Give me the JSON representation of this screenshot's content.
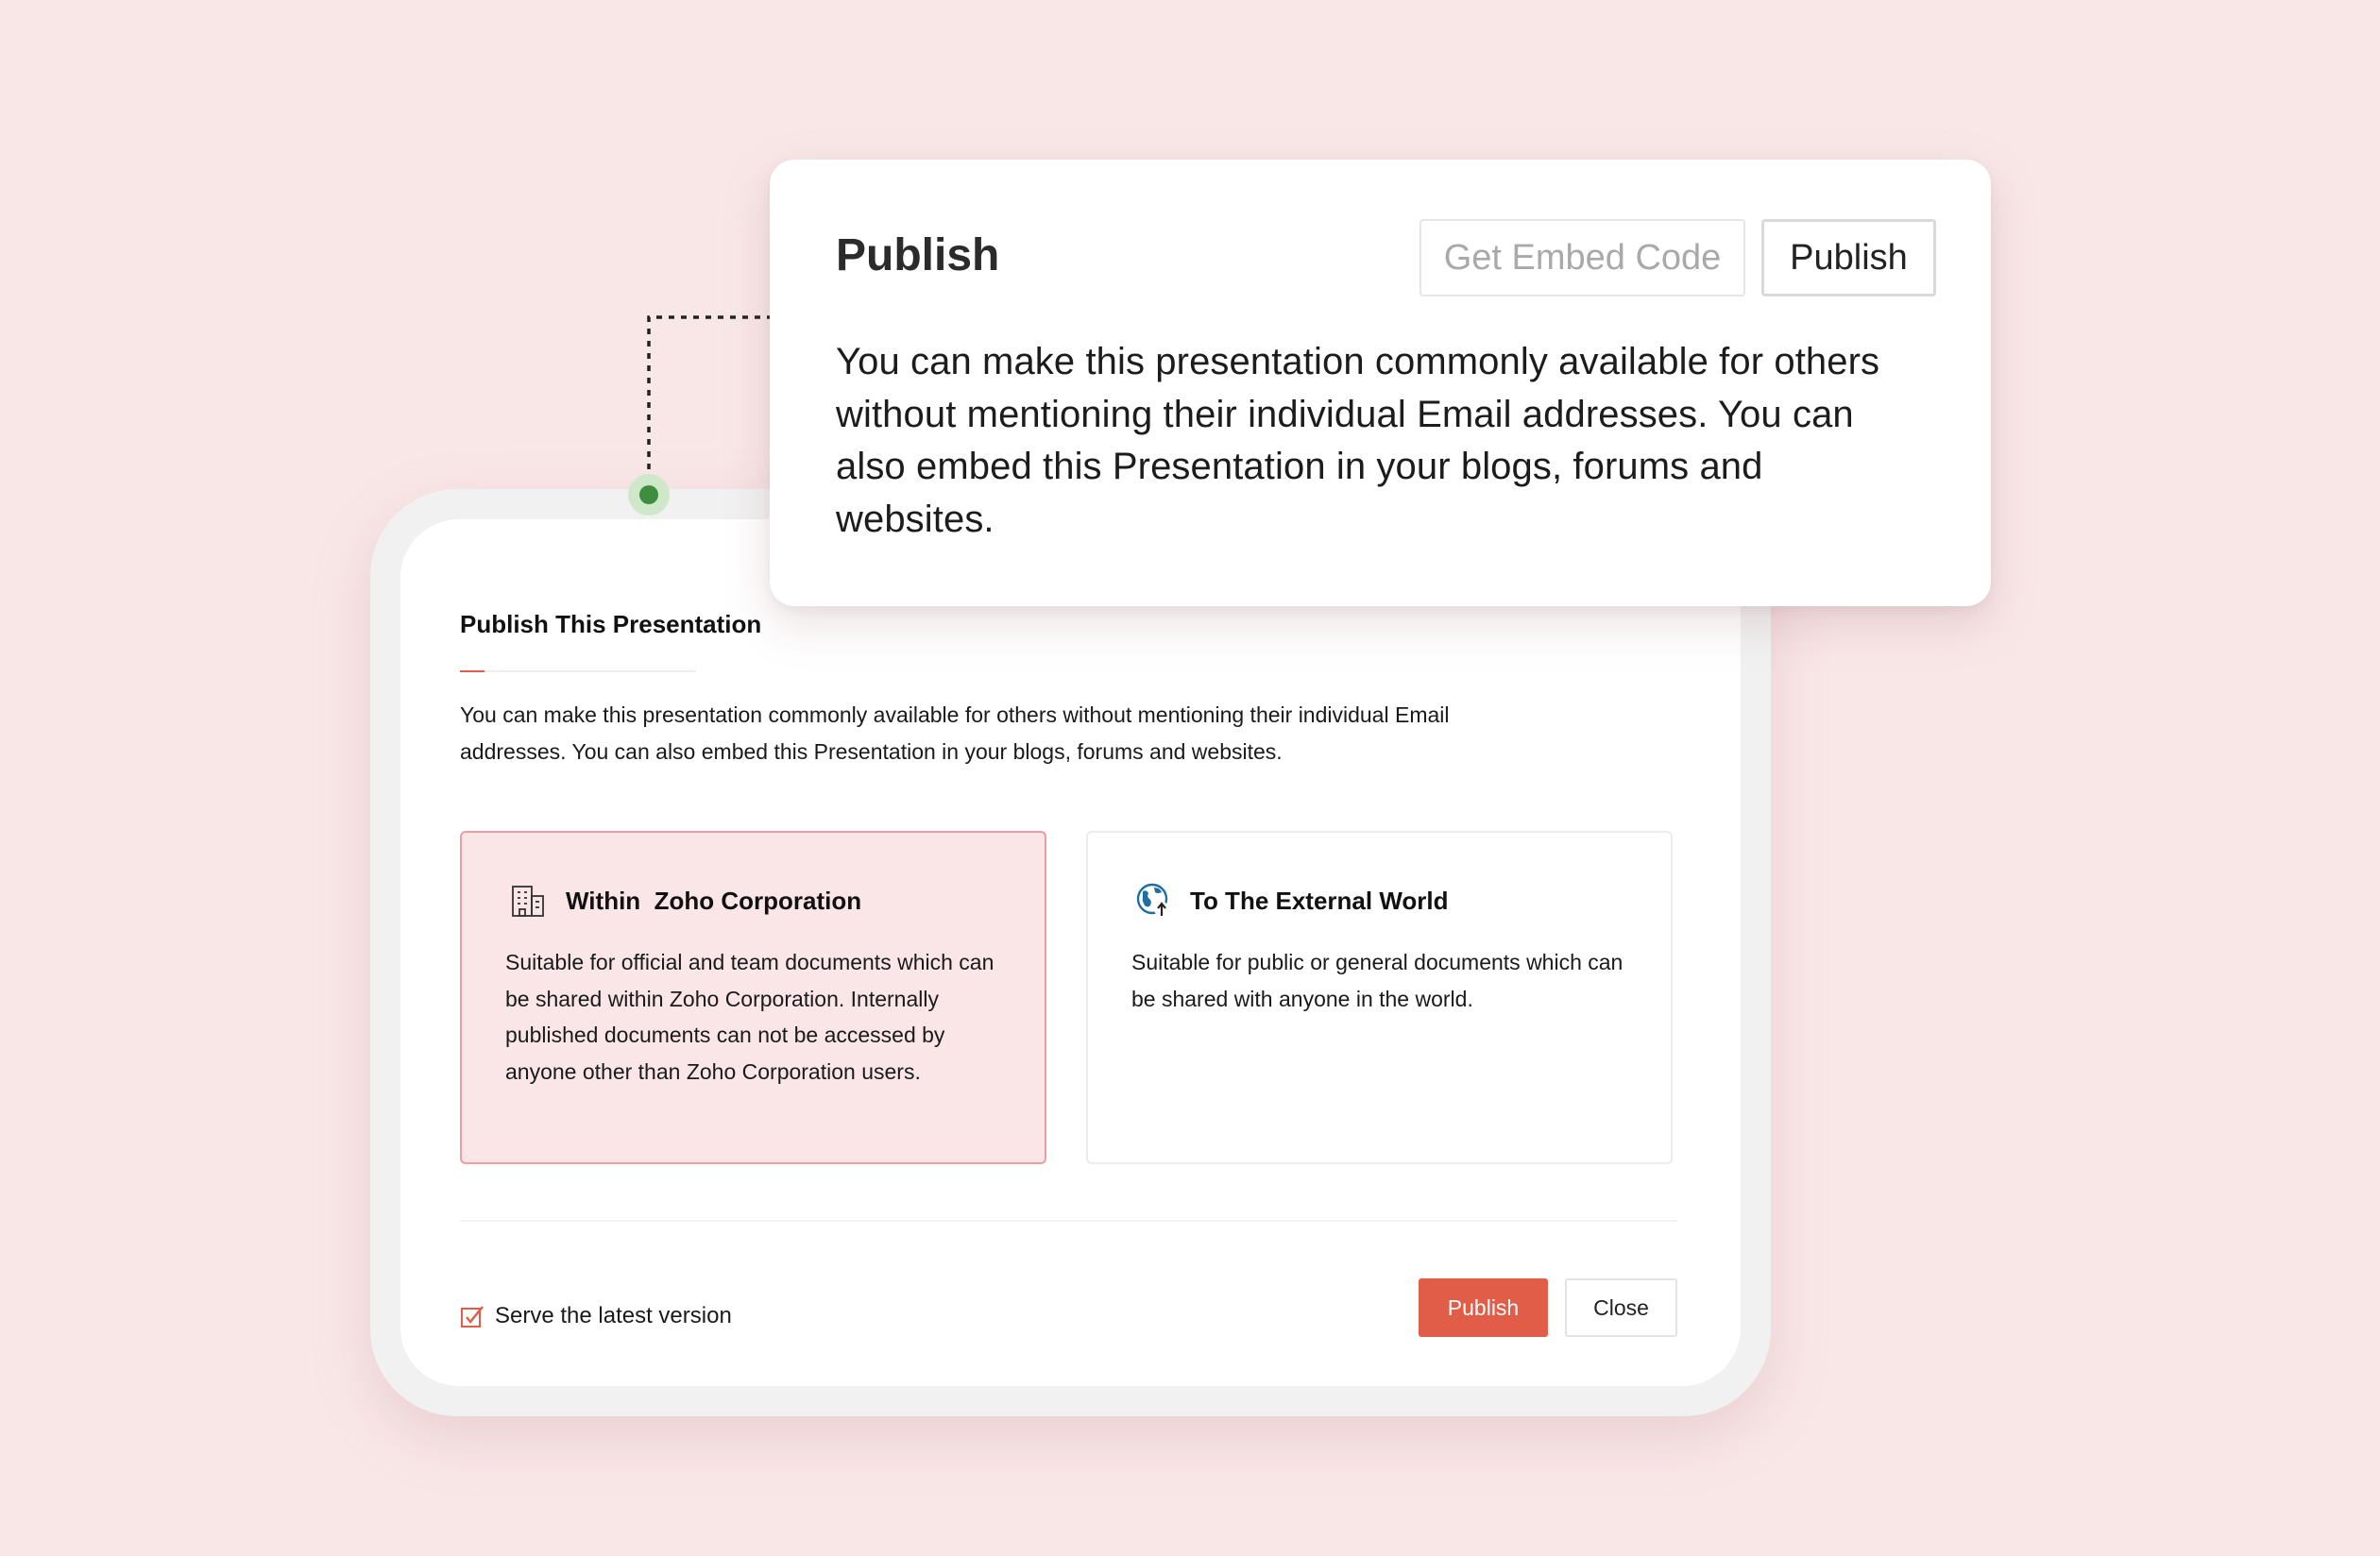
{
  "callout": {
    "title": "Publish",
    "embed_button_label": "Get Embed Code",
    "publish_button_label": "Publish",
    "description": "You can make this presentation commonly available for others without mentioning their individual Email addresses. You can also embed this Presentation in your blogs, forums and websites."
  },
  "dialog": {
    "title": "Publish This Presentation",
    "description": "You can make this presentation commonly available for others without mentioning their individual Email addresses. You can also embed this Presentation in your blogs, forums and websites.",
    "options": [
      {
        "icon": "building-icon",
        "title": "Within  Zoho Corporation",
        "description": "Suitable for official and team documents which can be shared within Zoho Corporation. Internally published documents can not be accessed by anyone other than Zoho Corporation users.",
        "selected": true
      },
      {
        "icon": "globe-upload-icon",
        "title": "To The External World",
        "description": "Suitable for public or general documents which can be shared with anyone in the world.",
        "selected": false
      }
    ],
    "serve_latest": {
      "label": "Serve the latest version",
      "checked": true
    },
    "publish_button_label": "Publish",
    "close_button_label": "Close"
  },
  "colors": {
    "background": "#f9e7e8",
    "accent": "#e15d47",
    "selected_card_bg": "#fbe6e7",
    "selected_card_border": "#ee9ca4",
    "connector_dot": "#3d8f3d"
  }
}
